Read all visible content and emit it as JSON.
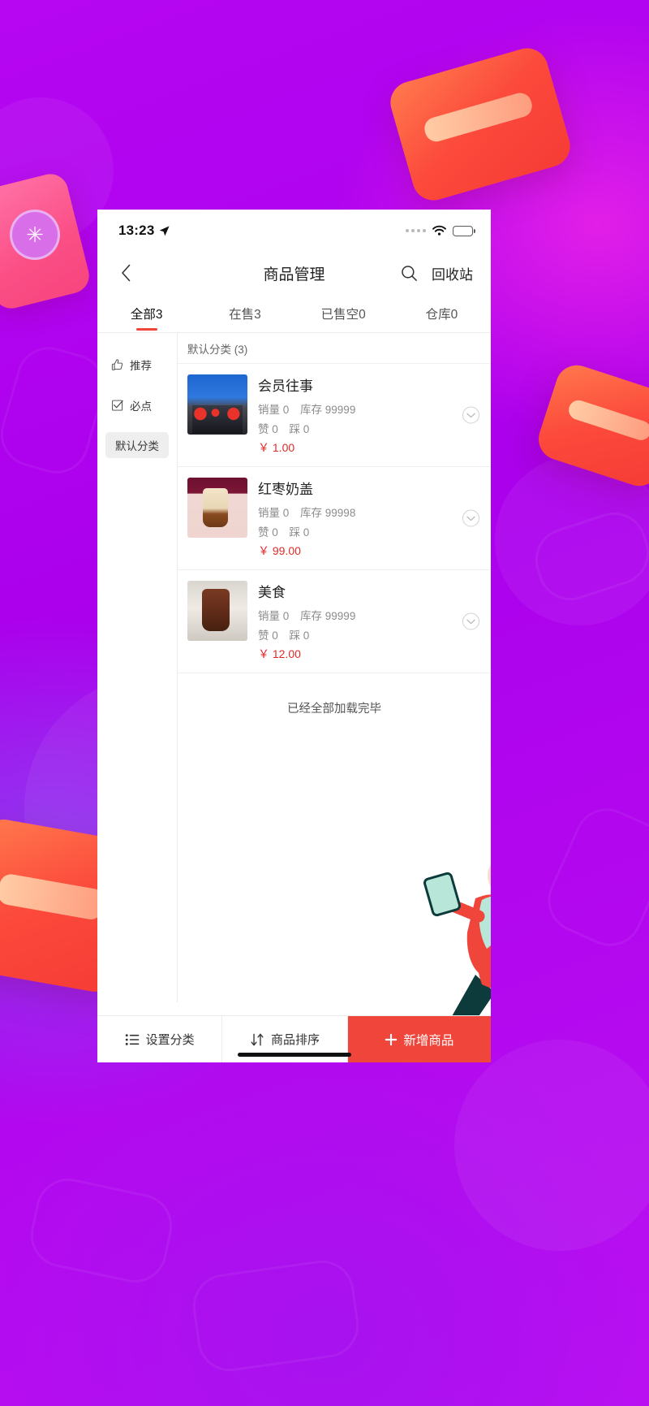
{
  "statusbar": {
    "time": "13:23",
    "location_icon": "location-arrow-icon",
    "signal_dots_icon": "signal-dots-icon",
    "wifi_icon": "wifi-icon",
    "battery_icon": "battery-charging-icon"
  },
  "navbar": {
    "back_icon": "chevron-left-icon",
    "title": "商品管理",
    "search_icon": "search-icon",
    "recycle_label": "回收站"
  },
  "tabs": [
    {
      "label": "全部3",
      "active": true
    },
    {
      "label": "在售3",
      "active": false
    },
    {
      "label": "已售空0",
      "active": false
    },
    {
      "label": "仓库0",
      "active": false
    }
  ],
  "sidebar": {
    "items": [
      {
        "label": "推荐",
        "icon": "thumbs-up-icon",
        "selected": false
      },
      {
        "label": "必点",
        "icon": "checkbox-checked-icon",
        "selected": false
      },
      {
        "label": "默认分类",
        "icon": "",
        "selected": true
      }
    ]
  },
  "list": {
    "category_header": "默认分类 (3)",
    "products": [
      {
        "name": "会员往事",
        "sales_label": "销量 0",
        "stock_label": "库存 99999",
        "like_label": "赞 0",
        "dislike_label": "踩 0",
        "price": "￥ 1.00",
        "expand_icon": "chevron-down-circle-icon"
      },
      {
        "name": "红枣奶盖",
        "sales_label": "销量 0",
        "stock_label": "库存 99998",
        "like_label": "赞 0",
        "dislike_label": "踩 0",
        "price": "￥ 99.00",
        "expand_icon": "chevron-down-circle-icon"
      },
      {
        "name": "美食",
        "sales_label": "销量 0",
        "stock_label": "库存 99999",
        "like_label": "赞 0",
        "dislike_label": "踩 0",
        "price": "￥ 12.00",
        "expand_icon": "chevron-down-circle-icon"
      }
    ],
    "end_text": "已经全部加载完毕"
  },
  "bottombar": {
    "set_category_label": "设置分类",
    "set_category_icon": "list-icon",
    "sort_label": "商品排序",
    "sort_icon": "sort-arrows-icon",
    "add_label": "新增商品",
    "add_icon": "plus-icon"
  },
  "colors": {
    "accent_red": "#f0453a",
    "price_red": "#e02a2a",
    "background_purple": "#b400f0"
  }
}
